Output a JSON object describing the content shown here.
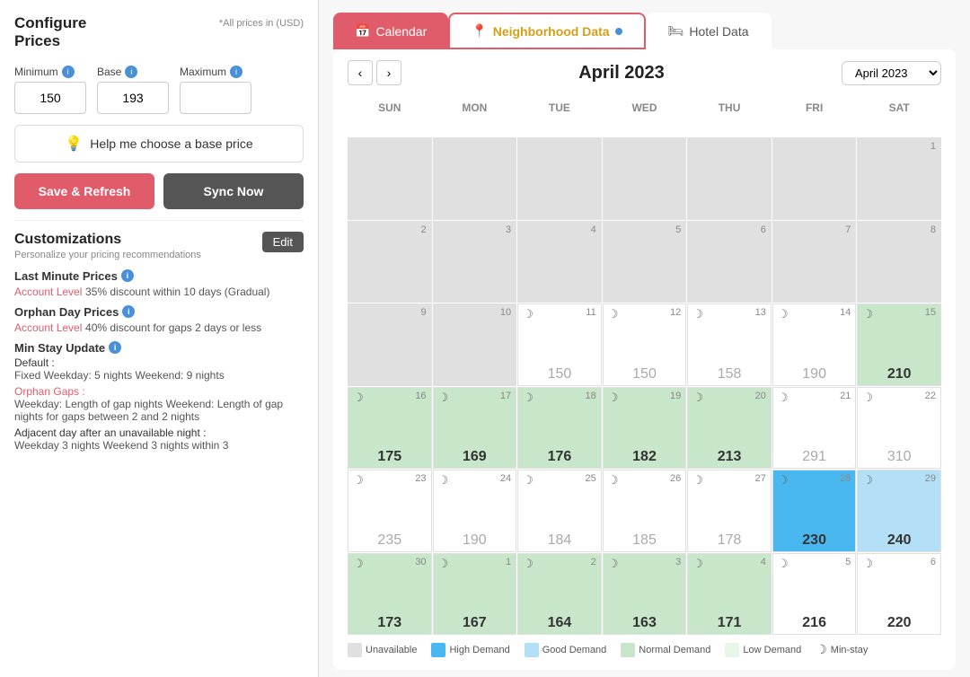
{
  "left": {
    "title": "Configure\nPrices",
    "prices_note": "*All prices in (USD)",
    "fields": {
      "minimum_label": "Minimum",
      "base_label": "Base",
      "maximum_label": "Maximum",
      "minimum_value": "150",
      "base_value": "193",
      "maximum_value": ""
    },
    "help_btn": "Help me choose a base price",
    "save_btn": "Save & Refresh",
    "sync_btn": "Sync Now",
    "customizations": {
      "title": "Customizations",
      "subtitle": "Personalize your pricing recommendations",
      "edit_btn": "Edit",
      "sections": [
        {
          "title": "Last Minute Prices",
          "link": "Account Level",
          "desc": "35% discount within 10 days (Gradual)"
        },
        {
          "title": "Orphan Day Prices",
          "link": "Account Level",
          "desc": "40% discount for gaps 2 days or less"
        },
        {
          "title": "Min Stay Update",
          "default_label": "Default :",
          "default_desc": "Fixed Weekday: 5 nights Weekend: 9 nights",
          "orphan_label": "Orphan Gaps :",
          "orphan_desc": "Weekday: Length of gap nights Weekend: Length of gap nights for gaps between 2 and 2 nights",
          "adjacent_label": "Adjacent day after an unavailable night :",
          "adjacent_desc": "Weekday 3 nights Weekend 3 nights within 3"
        }
      ]
    }
  },
  "right": {
    "tabs": [
      {
        "id": "calendar",
        "label": "Calendar",
        "icon": "📅"
      },
      {
        "id": "neighborhood",
        "label": "Neighborhood Data",
        "icon": "📍",
        "active": true
      },
      {
        "id": "hotel",
        "label": "Hotel Data",
        "icon": "🛏"
      }
    ],
    "calendar": {
      "title": "April 2023",
      "month_select": "April 2023",
      "days_of_week": [
        "SUN",
        "MON",
        "TUE",
        "WED",
        "THU",
        "FRI",
        "SAT"
      ],
      "cells": [
        {
          "day": "",
          "icon": "",
          "price": "",
          "style": "gray"
        },
        {
          "day": "",
          "icon": "",
          "price": "",
          "style": "gray"
        },
        {
          "day": "",
          "icon": "",
          "price": "",
          "style": "gray"
        },
        {
          "day": "",
          "icon": "",
          "price": "",
          "style": "gray"
        },
        {
          "day": "",
          "icon": "",
          "price": "",
          "style": "gray"
        },
        {
          "day": "",
          "icon": "",
          "price": "",
          "style": "gray"
        },
        {
          "day": "1",
          "icon": "",
          "price": "",
          "style": "gray"
        },
        {
          "day": "2",
          "icon": "",
          "price": "",
          "style": "gray"
        },
        {
          "day": "3",
          "icon": "",
          "price": "",
          "style": "gray"
        },
        {
          "day": "4",
          "icon": "",
          "price": "",
          "style": "gray"
        },
        {
          "day": "5",
          "icon": "",
          "price": "",
          "style": "gray"
        },
        {
          "day": "6",
          "icon": "",
          "price": "",
          "style": "gray"
        },
        {
          "day": "7",
          "icon": "",
          "price": "",
          "style": "gray"
        },
        {
          "day": "8",
          "icon": "",
          "price": "",
          "style": "gray"
        },
        {
          "day": "9",
          "icon": "",
          "price": "",
          "style": "gray"
        },
        {
          "day": "10",
          "icon": "",
          "price": "",
          "style": "gray"
        },
        {
          "day": "11",
          "icon": "ৎ",
          "price": "150",
          "style": "white",
          "price_muted": true
        },
        {
          "day": "12",
          "icon": "ৎ",
          "price": "150",
          "style": "white",
          "price_muted": true
        },
        {
          "day": "13",
          "icon": "ৎ",
          "price": "158",
          "style": "white",
          "price_muted": true
        },
        {
          "day": "14",
          "icon": "ৎ",
          "price": "190",
          "style": "white",
          "price_muted": true
        },
        {
          "day": "15",
          "icon": "ৎ",
          "price": "210",
          "style": "green"
        },
        {
          "day": "16",
          "icon": "ৎ",
          "price": "175",
          "style": "green"
        },
        {
          "day": "17",
          "icon": "ৎ",
          "price": "169",
          "style": "green"
        },
        {
          "day": "18",
          "icon": "ৎ",
          "price": "176",
          "style": "green"
        },
        {
          "day": "19",
          "icon": "ৎ",
          "price": "182",
          "style": "green"
        },
        {
          "day": "20",
          "icon": "ৎ",
          "price": "213",
          "style": "green"
        },
        {
          "day": "21",
          "icon": "ৎ",
          "price": "291",
          "style": "white",
          "price_muted": true
        },
        {
          "day": "22",
          "icon": "ৎ",
          "price": "310",
          "style": "white",
          "price_muted": true
        },
        {
          "day": "23",
          "icon": "ৎ",
          "price": "235",
          "style": "white",
          "price_muted": true
        },
        {
          "day": "24",
          "icon": "ৎ",
          "price": "190",
          "style": "white",
          "price_muted": true
        },
        {
          "day": "25",
          "icon": "ৎ",
          "price": "184",
          "style": "white",
          "price_muted": true
        },
        {
          "day": "26",
          "icon": "ৎ",
          "price": "185",
          "style": "white",
          "price_muted": true
        },
        {
          "day": "27",
          "icon": "ৎ",
          "price": "178",
          "style": "white",
          "price_muted": true
        },
        {
          "day": "28",
          "icon": "ৎ",
          "price": "230",
          "style": "blue"
        },
        {
          "day": "29",
          "icon": "ৎ",
          "price": "240",
          "style": "light-blue"
        },
        {
          "day": "30",
          "icon": "ৎ",
          "price": "173",
          "style": "green"
        },
        {
          "day": "1",
          "icon": "ৎ",
          "price": "167",
          "style": "green",
          "other_month": true
        },
        {
          "day": "2",
          "icon": "ৎ",
          "price": "164",
          "style": "green",
          "other_month": true
        },
        {
          "day": "3",
          "icon": "ৎ",
          "price": "163",
          "style": "green",
          "other_month": true
        },
        {
          "day": "4",
          "icon": "ৎ",
          "price": "171",
          "style": "green",
          "other_month": true
        },
        {
          "day": "5",
          "icon": "ৎ",
          "price": "216",
          "style": "white",
          "other_month": true
        },
        {
          "day": "6",
          "icon": "ৎ",
          "price": "220",
          "style": "white",
          "other_month": true
        }
      ],
      "legend": [
        {
          "label": "Unavailable",
          "color": "#e0e0e0",
          "type": "box"
        },
        {
          "label": "High Demand",
          "color": "#4ab8f0",
          "type": "box"
        },
        {
          "label": "Good Demand",
          "color": "#b3e0f7",
          "type": "box"
        },
        {
          "label": "Normal Demand",
          "color": "#c8e6c9",
          "type": "box"
        },
        {
          "label": "Low Demand",
          "color": "#e8f5e9",
          "type": "box"
        },
        {
          "label": "Min-stay",
          "color": "#999",
          "type": "circle",
          "char": "☽"
        }
      ]
    }
  }
}
